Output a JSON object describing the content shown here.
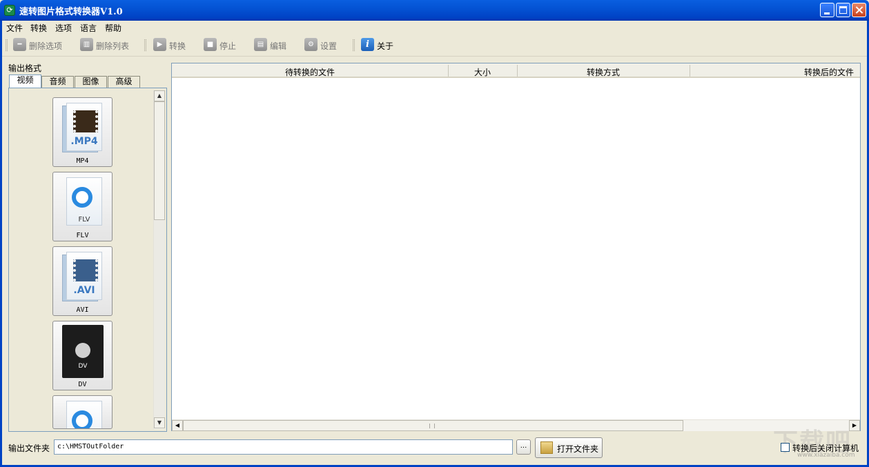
{
  "window": {
    "title": "速转图片格式转换器V1.0"
  },
  "menu": [
    "文件",
    "转换",
    "选项",
    "语言",
    "帮助"
  ],
  "toolbar": {
    "delete_selected": "删除选项",
    "delete_list": "删除列表",
    "convert": "转换",
    "stop": "停止",
    "edit": "编辑",
    "settings": "设置",
    "about": "关于"
  },
  "output_format": {
    "label": "输出格式",
    "tabs": [
      "视频",
      "音频",
      "图像",
      "高级"
    ],
    "active_tab": "视频",
    "formats": [
      {
        "name": "MP4",
        "icon_text": ".MP4"
      },
      {
        "name": "FLV",
        "icon_text": "FLV"
      },
      {
        "name": "AVI",
        "icon_text": ".AVI"
      },
      {
        "name": "DV",
        "icon_text": "DV"
      }
    ]
  },
  "file_list": {
    "columns": [
      "待转换的文件",
      "大小",
      "转换方式",
      "转换后的文件"
    ],
    "rows": []
  },
  "footer": {
    "output_folder_label": "输出文件夹",
    "output_folder_value": "c:\\HMSTOutFolder",
    "browse_label": "...",
    "open_folder_label": "打开文件夹",
    "shutdown_label": "转换后关闭计算机",
    "shutdown_checked": false
  },
  "watermark": {
    "main": "下载吧",
    "sub": "www.xiazaiba.com"
  }
}
